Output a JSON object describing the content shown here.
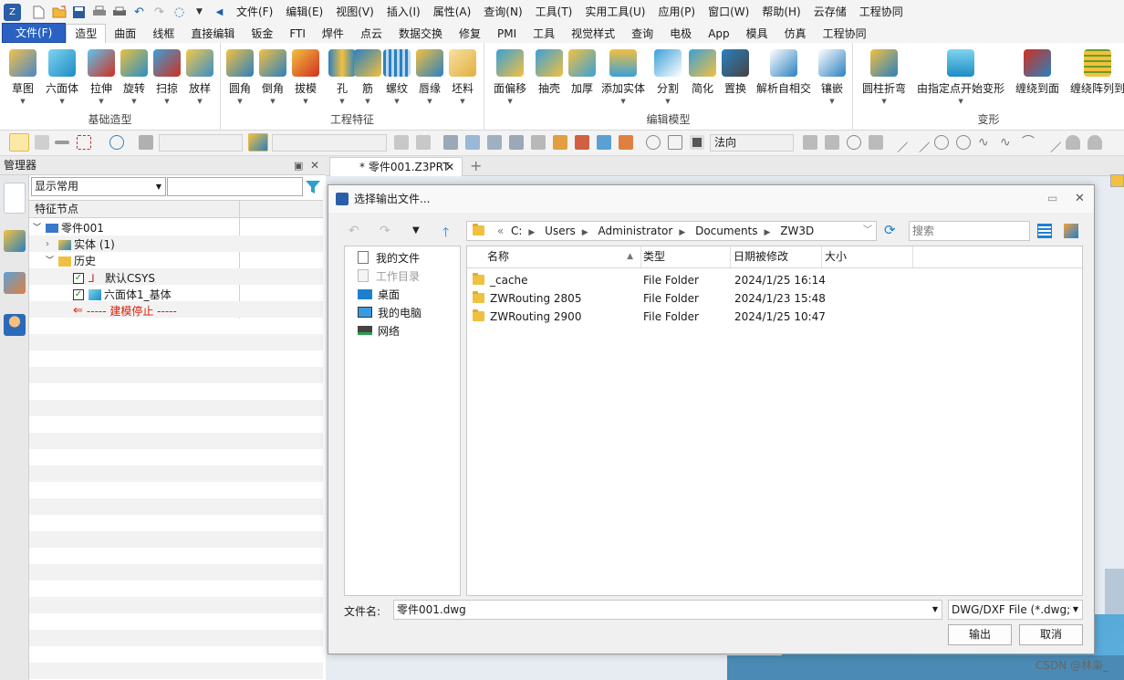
{
  "titlebar": {
    "menus": [
      "文件(F)",
      "编辑(E)",
      "视图(V)",
      "插入(I)",
      "属性(A)",
      "查询(N)",
      "工具(T)",
      "实用工具(U)",
      "应用(P)",
      "窗口(W)",
      "帮助(H)",
      "云存储",
      "工程协同"
    ]
  },
  "ribbon_tabs": [
    "文件(F)",
    "造型",
    "曲面",
    "线框",
    "直接编辑",
    "钣金",
    "FTI",
    "焊件",
    "点云",
    "数据交换",
    "修复",
    "PMI",
    "工具",
    "视觉样式",
    "查询",
    "电极",
    "App",
    "模具",
    "仿真",
    "工程协同"
  ],
  "ribbon": {
    "groups": [
      {
        "title": "基础造型",
        "buttons": [
          "草图",
          "六面体",
          "拉伸",
          "旋转",
          "扫掠",
          "放样"
        ]
      },
      {
        "title": "工程特征",
        "buttons": [
          "圆角",
          "倒角",
          "拔模",
          "孔",
          "筋",
          "螺纹",
          "唇缘",
          "坯料"
        ]
      },
      {
        "title": "编辑模型",
        "buttons": [
          "面偏移",
          "抽壳",
          "加厚",
          "添加实体",
          "分割",
          "简化",
          "置换",
          "解析自相交",
          "镶嵌"
        ]
      },
      {
        "title": "变形",
        "buttons": [
          "圆柱折弯",
          "由指定点开始变形",
          "缠绕到面",
          "缠绕阵列到"
        ]
      }
    ]
  },
  "toolbar2": {
    "normal_combo": "法向"
  },
  "manager": {
    "title": "管理器",
    "filter_value": "显示常用",
    "tree_header": "特征节点",
    "tree": [
      {
        "label": "零件001",
        "level": 0
      },
      {
        "label": "实体 (1)",
        "level": 1
      },
      {
        "label": "历史",
        "level": 1
      },
      {
        "label": "默认CSYS",
        "level": 2
      },
      {
        "label": "六面体1_基体",
        "level": 2
      },
      {
        "label": "----- 建模停止 -----",
        "level": 2
      }
    ]
  },
  "doc_tab": "* 零件001.Z3PRT",
  "dialog": {
    "title": "选择输出文件...",
    "path": [
      "C:",
      "Users",
      "Administrator",
      "Documents",
      "ZW3D"
    ],
    "search_placeholder": "搜索",
    "nav": [
      "我的文件",
      "工作目录",
      "桌面",
      "我的电脑",
      "网络"
    ],
    "columns": [
      "名称",
      "类型",
      "日期被修改",
      "大小"
    ],
    "files": [
      {
        "name": "_cache",
        "type": "File Folder",
        "date": "2024/1/25 16:14",
        "size": ""
      },
      {
        "name": "ZWRouting 2805",
        "type": "File Folder",
        "date": "2024/1/23 15:48",
        "size": ""
      },
      {
        "name": "ZWRouting 2900",
        "type": "File Folder",
        "date": "2024/1/25 10:47",
        "size": ""
      }
    ],
    "filename_label": "文件名:",
    "filename_value": "零件001.dwg",
    "filetype": "DWG/DXF File (*.dwg;*.",
    "ok_label": "输出",
    "cancel_label": "取消"
  },
  "watermark": "CSDN @林枭_",
  "colors": {
    "accent": "#2a62c4",
    "selected_tab_bg": "#ffffff",
    "warning_text": "#d81e06"
  }
}
